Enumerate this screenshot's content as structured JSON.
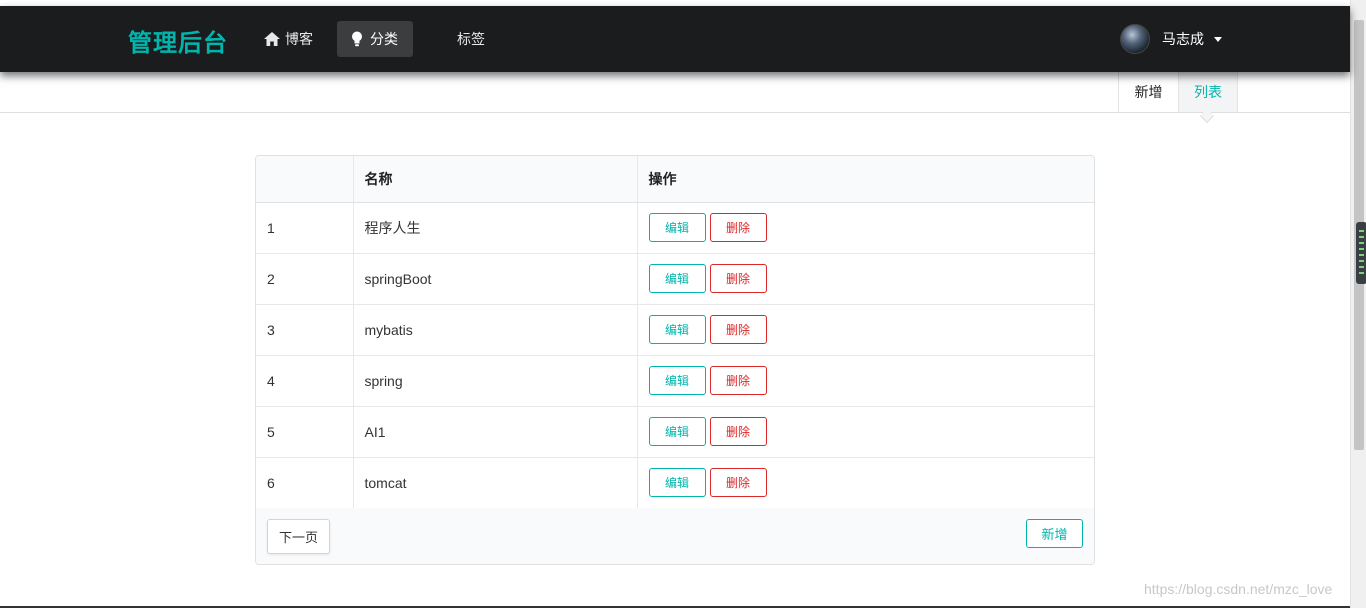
{
  "app": {
    "brand": "管理后台"
  },
  "nav": {
    "items": [
      {
        "label": "博客",
        "icon": "home-icon",
        "active": false
      },
      {
        "label": "分类",
        "icon": "lightbulb-icon",
        "active": true
      },
      {
        "label": "标签",
        "icon": "",
        "active": false
      }
    ]
  },
  "user": {
    "name": "马志成"
  },
  "subnav": {
    "new_label": "新增",
    "list_label": "列表"
  },
  "table": {
    "headers": [
      "",
      "名称",
      "操作"
    ],
    "rows": [
      {
        "id": "1",
        "name": "程序人生"
      },
      {
        "id": "2",
        "name": "springBoot"
      },
      {
        "id": "3",
        "name": "mybatis"
      },
      {
        "id": "4",
        "name": "spring"
      },
      {
        "id": "5",
        "name": "AI1"
      },
      {
        "id": "6",
        "name": "tomcat"
      }
    ],
    "edit_label": "编辑",
    "delete_label": "删除"
  },
  "footer": {
    "next_label": "下一页",
    "add_label": "新增"
  },
  "watermark": "https://blog.csdn.net/mzc_love",
  "colors": {
    "accent": "#00b5ad",
    "danger": "#db2828",
    "navbar": "#1b1c1d"
  }
}
